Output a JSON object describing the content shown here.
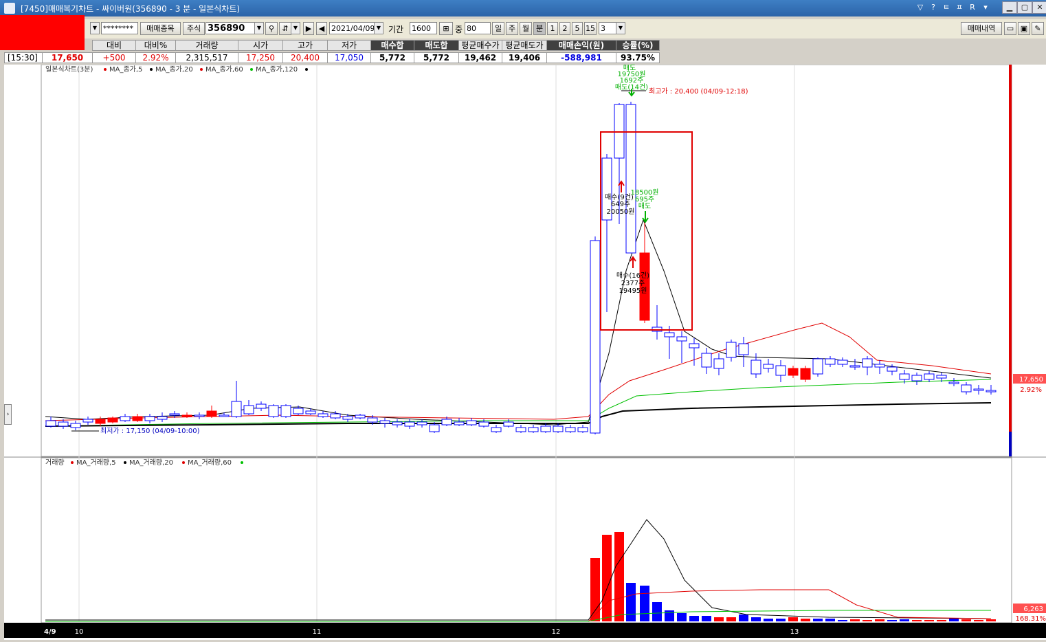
{
  "window": {
    "title": "[7450]매매복기차트 - 싸이버원(356890 - 3 분 - 일본식차트)",
    "controls": [
      "▽",
      "?",
      "ㅌ",
      "ㅍ",
      "R",
      "▾"
    ]
  },
  "toolbar": {
    "password": "********",
    "trade_items_label": "매매종목",
    "stock_label": "주식",
    "stock_code": "356890",
    "date": "2021/04/09",
    "period_label": "기간",
    "period_value": "1600",
    "count_label": "중",
    "count_value": "80",
    "interval_buttons": [
      "일",
      "주",
      "월",
      "분",
      "1",
      "2",
      "5",
      "15"
    ],
    "interval_value": "3",
    "history_label": "매매내역"
  },
  "quote": {
    "headers": [
      "",
      "대비",
      "대비%",
      "거래량",
      "시가",
      "고가",
      "저가",
      "매수합",
      "매도합",
      "평균매수가",
      "평균매도가",
      "매매손익(원)",
      "승률(%)"
    ],
    "values": [
      "[15:30]",
      "17,650",
      "+500",
      "2.92%",
      "2,315,517",
      "17,250",
      "20,400",
      "17,050",
      "5,772",
      "5,772",
      "19,462",
      "19,406",
      "-588,981",
      "93.75%"
    ]
  },
  "price_panel": {
    "legend_title": "일본식차트(3분)",
    "legend_items": [
      {
        "label": "MA_종가,5",
        "color": "#000000"
      },
      {
        "label": "MA_종가,20",
        "color": "#e00000"
      },
      {
        "label": "MA_종가,60",
        "color": "#00c000"
      },
      {
        "label": "MA_종가,120",
        "color": "#000000"
      }
    ],
    "high_label": "최고가 : 20,400 (04/09-12:18)",
    "low_label": "최저가 : 17,150 (04/09-10:00)",
    "annotations": {
      "sell1": [
        "매도",
        "19750원",
        "1692주",
        "매도(14건)"
      ],
      "buy1": [
        "매수(9건)",
        "649주",
        "20050원"
      ],
      "sell2": [
        "18500원",
        "695주",
        "매도"
      ],
      "buy2": [
        "매수(16건)",
        "2377주",
        "19495원"
      ]
    },
    "price_tag": "17,650",
    "pct_tag": "2.92%"
  },
  "volume_panel": {
    "legend_title": "거래량",
    "legend_items": [
      {
        "label": "MA_거래량,5",
        "color": "#000000"
      },
      {
        "label": "MA_거래량,20",
        "color": "#e00000"
      },
      {
        "label": "MA_거래량,60",
        "color": "#00c000"
      }
    ],
    "vol_tag": "6,263",
    "vol_pct_tag": "168.31%"
  },
  "x_axis": {
    "date_label": "4/9",
    "hours": [
      "10",
      "11",
      "12",
      "13"
    ]
  },
  "colors": {
    "up": "#ff0000",
    "down": "#0000ff",
    "accent": "#2b63a8"
  }
}
